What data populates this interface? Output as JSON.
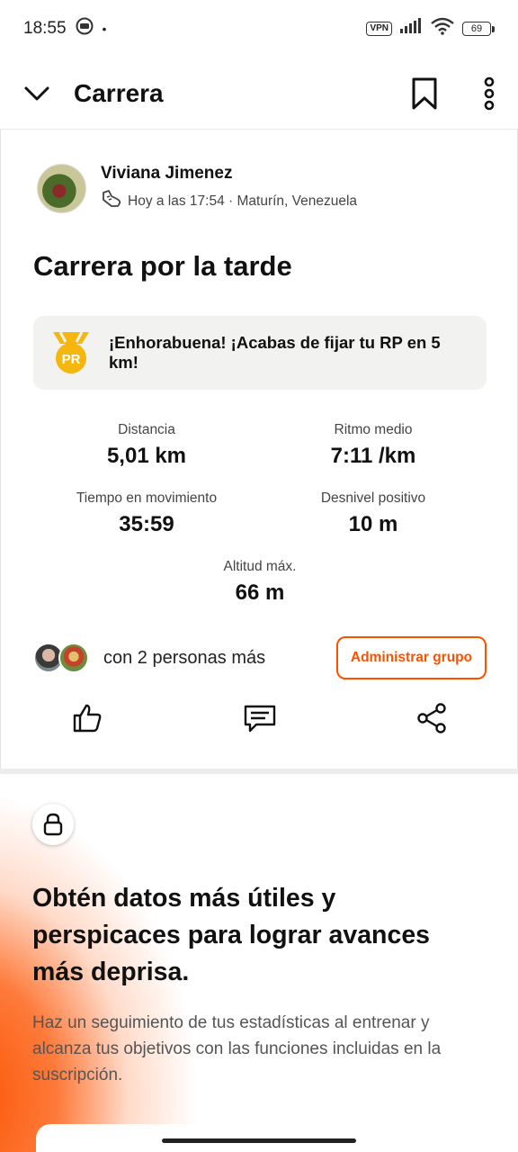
{
  "status_bar": {
    "time": "18:55",
    "dot": "•",
    "vpn": "VPN",
    "battery": "69"
  },
  "header": {
    "title": "Carrera",
    "icons": [
      "chevron-down-icon",
      "bookmark-icon",
      "more-vertical-icon"
    ]
  },
  "activity": {
    "athlete_name": "Viviana Jimenez",
    "meta": "Hoy a las 17:54 · Maturín, Venezuela",
    "title": "Carrera por la tarde",
    "pr_medal_label": "PR",
    "pr_message": "¡Enhorabuena! ¡Acabas de fijar tu RP en 5 km!",
    "stats": [
      {
        "label": "Distancia",
        "value": "5,01 km"
      },
      {
        "label": "Ritmo medio",
        "value": "7:11 /km"
      },
      {
        "label": "Tiempo en movimiento",
        "value": "35:59"
      },
      {
        "label": "Desnivel positivo",
        "value": "10 m"
      },
      {
        "label": "Altitud máx.",
        "value": "66 m"
      }
    ],
    "group_text": "con 2 personas más",
    "manage_group_label": "Administrar grupo"
  },
  "promo": {
    "title": "Obtén datos más útiles y perspicaces para lograr avances más deprisa.",
    "body": "Haz un seguimiento de tus estadísticas al entrenar y alcanza tus objetivos con las funciones incluidas en la suscripción."
  },
  "colors": {
    "accent": "#fc5200",
    "medal": "#f5b60d"
  }
}
